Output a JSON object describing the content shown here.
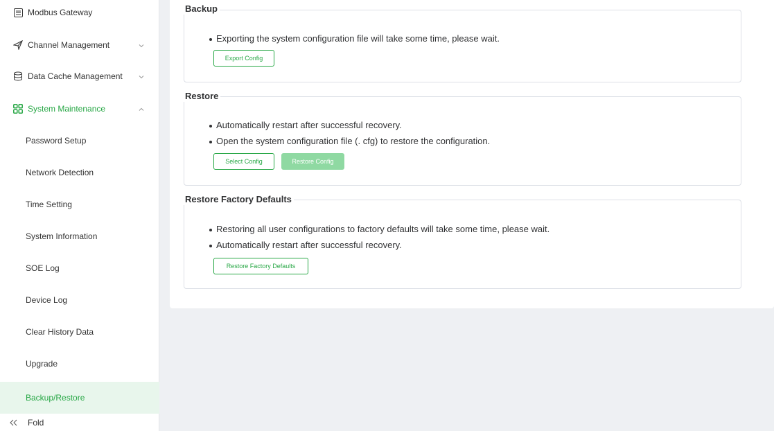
{
  "sidebar": {
    "top_items": [
      {
        "label": "Modbus Gateway",
        "icon": "modbus-gateway-icon"
      },
      {
        "label": "Channel Management",
        "icon": "channel-icon"
      },
      {
        "label": "Data Cache Management",
        "icon": "data-cache-icon"
      },
      {
        "label": "System Maintenance",
        "icon": "system-maintenance-icon"
      }
    ],
    "sub_items": [
      {
        "label": "Password Setup"
      },
      {
        "label": "Network Detection"
      },
      {
        "label": "Time Setting"
      },
      {
        "label": "System Information"
      },
      {
        "label": "SOE Log"
      },
      {
        "label": "Device Log"
      },
      {
        "label": "Clear History Data"
      },
      {
        "label": "Upgrade"
      },
      {
        "label": "Backup/Restore"
      }
    ],
    "active_item": "Backup/Restore",
    "fold_label": "Fold"
  },
  "main": {
    "backup": {
      "title": "Backup",
      "bullets": [
        "Exporting the system configuration file will take some time, please wait."
      ],
      "export_button": "Export Config"
    },
    "restore": {
      "title": "Restore",
      "bullets": [
        "Automatically restart after successful recovery.",
        "Open the system configuration file (. cfg) to restore the configuration."
      ],
      "select_button": "Select Config",
      "restore_button": "Restore Config"
    },
    "factory": {
      "title": "Restore Factory Defaults",
      "bullets": [
        "Restoring all user configurations to factory defaults will take some time, please wait.",
        "Automatically restart after successful recovery."
      ],
      "restore_button": "Restore Factory Defaults"
    }
  },
  "colors": {
    "accent": "#27a745",
    "accent_light": "#8fd9a2",
    "active_bg": "#e8f6ec",
    "page_bg": "#eef0f3"
  }
}
